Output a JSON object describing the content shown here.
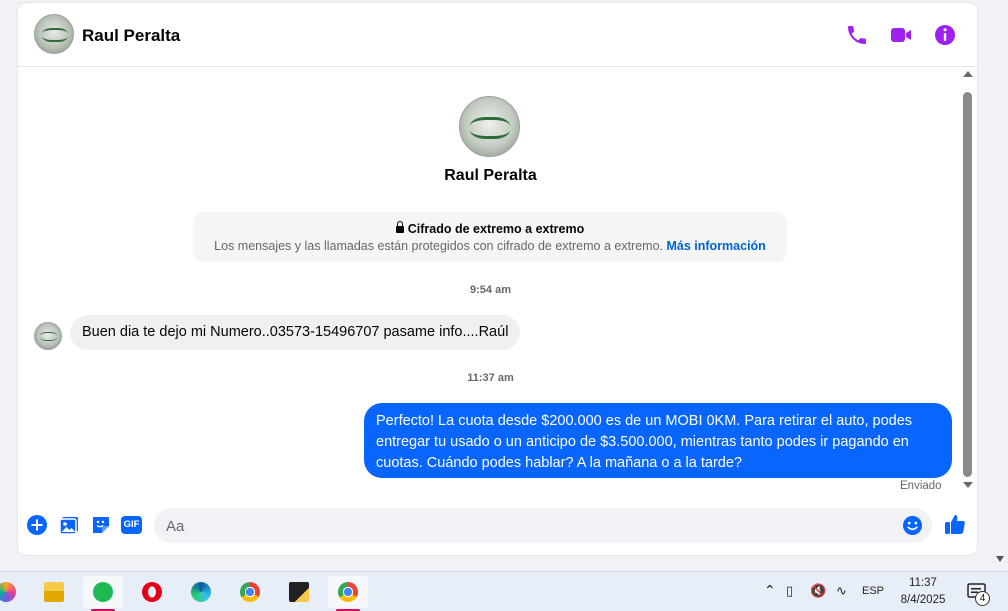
{
  "header": {
    "contact_name": "Raul Peralta",
    "actions": [
      {
        "name": "phone-icon"
      },
      {
        "name": "video-camera-icon"
      },
      {
        "name": "info-icon"
      }
    ]
  },
  "profile": {
    "name": "Raul Peralta"
  },
  "encryption": {
    "title": "Cifrado de extremo a extremo",
    "text": "Los mensajes y las llamadas están protegidos con cifrado de extremo a extremo.",
    "link": "Más información"
  },
  "messages": [
    {
      "timestamp": "9:54 am",
      "direction": "incoming",
      "text": "Buen dia te dejo mi Numero..03573-15496707 pasame info....Raúl"
    },
    {
      "timestamp": "11:37 am",
      "direction": "outgoing",
      "text": "Perfecto! La cuota desde $200.000 es de un MOBI 0KM. Para retirar el auto, podes entregar tu usado o un anticipo de $3.500.000, mientras tanto podes ir pagando en cuotas. Cuándo podes hablar? A la mañana o a la tarde?"
    }
  ],
  "sent_status": "Enviado",
  "composer": {
    "placeholder": "Aa",
    "gif_label": "GIF"
  },
  "colors": {
    "accent_purple": "#a020f0",
    "outgoing_bubble": "#0866ff",
    "incoming_bubble": "#f0f0f0"
  },
  "taskbar": {
    "apps": [
      "copilot-icon",
      "file-explorer-icon",
      "spotify-icon",
      "opera-icon",
      "edge-icon",
      "chrome-icon",
      "sticky-notes-icon",
      "chrome-profile-icon"
    ],
    "language": "ESP",
    "time": "11:37",
    "date": "8/4/2025",
    "notification_count": "4"
  }
}
